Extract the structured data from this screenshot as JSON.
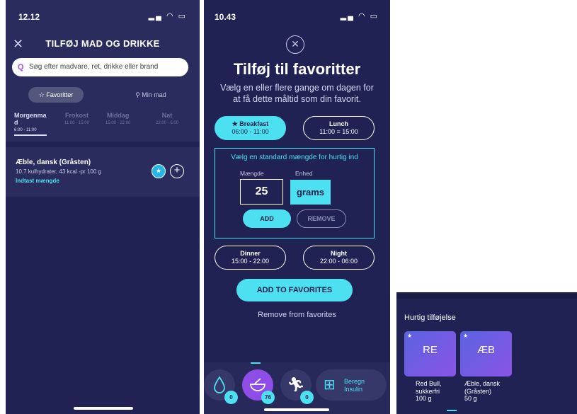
{
  "panel1": {
    "status_time": "12.12",
    "title": "TILFØJ MAD OG DRIKKE",
    "search_placeholder": "Søg efter madvare, ret, drikke eller brand",
    "tabs": {
      "favorites": "Favoritter",
      "my_food": "Min mad"
    },
    "meals": [
      {
        "name": "Morgenma d",
        "time": "6:00 - 11:00"
      },
      {
        "name": "Frokost",
        "time": "11:00 - 15:00"
      },
      {
        "name": "Middag",
        "time": "15:00 - 22:00"
      },
      {
        "name": "Nat",
        "time": "22:00 - 6:00"
      }
    ],
    "food": {
      "name": "Æble, dansk (Gråsten)",
      "info": "10.7 kulhydrater, 43 kcal -pr 100 g",
      "link": "Indtast mængde"
    }
  },
  "panel2": {
    "status_time": "10.43",
    "title": "Tilføj til favoritter",
    "description": "Vælg en eller flere gange om dagen for at få dette måltid som din favorit.",
    "slots": [
      {
        "name": "★ Breakfast",
        "time": "06:00 - 11:00",
        "selected": true
      },
      {
        "name": "Lunch",
        "time": "11:00 = 15:00",
        "selected": false
      },
      {
        "name": "Dinner",
        "time": "15:00 - 22:00",
        "selected": false
      },
      {
        "name": "Night",
        "time": "22:00 - 06:00",
        "selected": false
      }
    ],
    "standard_label": "Vælg en standard mængde for hurtig ind",
    "quantity_caption": "Mængde",
    "unit_caption": "Enhed",
    "quantity": "25",
    "unit": "grams",
    "add_label": "ADD",
    "remove_label": "REMOVE",
    "add_to_favorites": "ADD TO FAVORITES",
    "remove_from_favorites": "Remove from favorites",
    "nav": {
      "water_badge": "0",
      "food_badge": "76",
      "activity_badge": "0",
      "beregn_line1": "Beregn",
      "beregn_line2": "Insulin"
    }
  },
  "panel3": {
    "heading": "Hurtig tilføjelse",
    "cards": [
      {
        "abbr": "RE",
        "caption_lines": [
          "Red Bull,",
          "sukkerfri",
          "100  g"
        ]
      },
      {
        "abbr": "ÆB",
        "caption_lines": [
          "Æble, dansk",
          "(Gråsten)",
          "50  g"
        ]
      }
    ]
  },
  "colors": {
    "background": "#202254",
    "accent": "#4de0f0",
    "primary_purple": "#8e4de6",
    "panel": "#2a2c5e"
  },
  "icons": [
    "close-icon",
    "search-icon",
    "star-icon",
    "user-icon",
    "plus-icon",
    "water-drop-icon",
    "bowl-icon",
    "running-icon",
    "calculator-icon"
  ]
}
